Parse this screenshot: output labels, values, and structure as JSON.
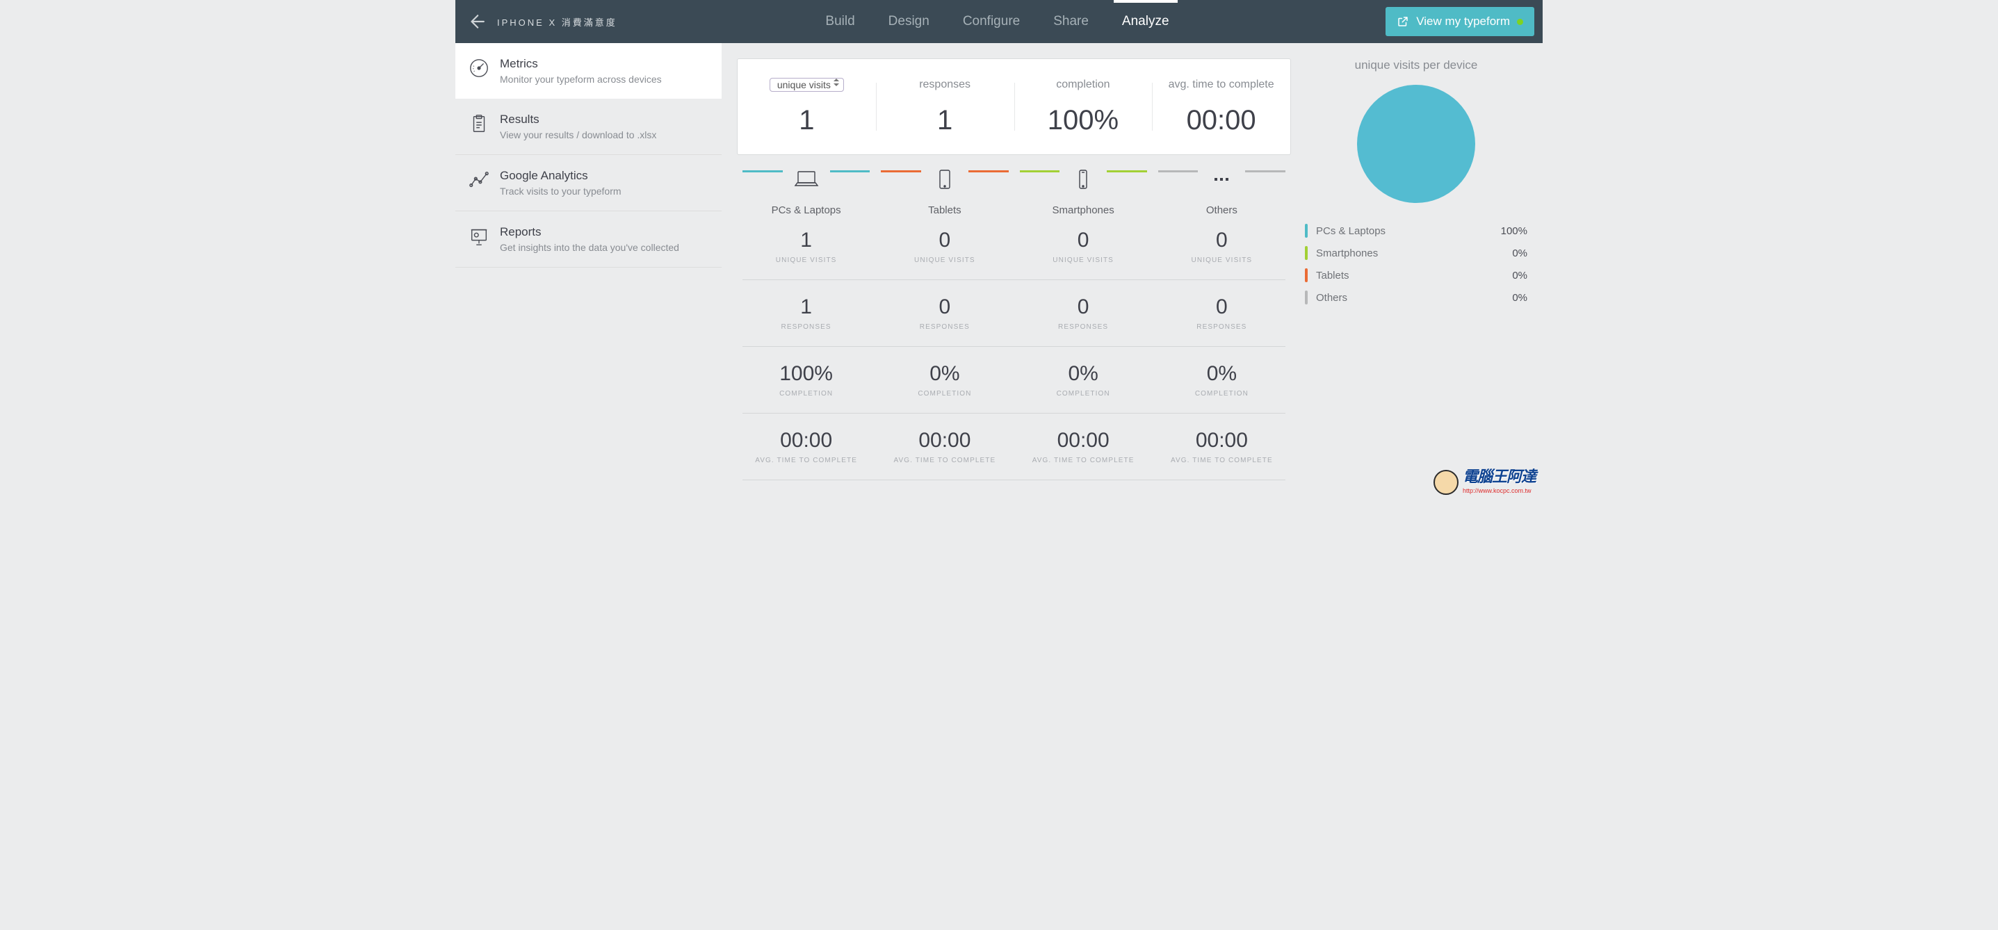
{
  "header": {
    "form_title": "IPHONE X 消費滿意度",
    "nav": [
      "Build",
      "Design",
      "Configure",
      "Share",
      "Analyze"
    ],
    "active_nav": "Analyze",
    "view_btn": "View my typeform"
  },
  "sidebar": [
    {
      "title": "Metrics",
      "sub": "Monitor your typeform across devices",
      "icon": "gauge",
      "active": true
    },
    {
      "title": "Results",
      "sub": "View your results / download to .xlsx",
      "icon": "clipboard"
    },
    {
      "title": "Google Analytics",
      "sub": "Track visits to your typeform",
      "icon": "chart"
    },
    {
      "title": "Reports",
      "sub": "Get insights into the data you've collected",
      "icon": "presentation"
    }
  ],
  "summary": {
    "select": "unique visits",
    "unique_visits": "1",
    "responses_label": "responses",
    "responses": "1",
    "completion_label": "completion",
    "completion": "100%",
    "avg_label": "avg. time to complete",
    "avg": "00:00"
  },
  "devices": {
    "columns": [
      {
        "name": "PCs & Laptops",
        "color": "#4fbbc6",
        "icon": "laptop",
        "unique_visits": "1",
        "responses": "1",
        "completion": "100%",
        "avg": "00:00"
      },
      {
        "name": "Tablets",
        "color": "#ea6b35",
        "icon": "tablet",
        "unique_visits": "0",
        "responses": "0",
        "completion": "0%",
        "avg": "00:00"
      },
      {
        "name": "Smartphones",
        "color": "#a2d035",
        "icon": "phone",
        "unique_visits": "0",
        "responses": "0",
        "completion": "0%",
        "avg": "00:00"
      },
      {
        "name": "Others",
        "color": "#b7b8b9",
        "icon": "dots",
        "unique_visits": "0",
        "responses": "0",
        "completion": "0%",
        "avg": "00:00"
      }
    ],
    "row_labels": {
      "unique": "UNIQUE VISITS",
      "responses": "RESPONSES",
      "completion": "COMPLETION",
      "avg": "AVG. TIME TO COMPLETE"
    }
  },
  "right": {
    "title": "unique visits per device",
    "legend": [
      {
        "name": "PCs & Laptops",
        "value": "100%",
        "color": "#4fbbc6"
      },
      {
        "name": "Smartphones",
        "value": "0%",
        "color": "#a2d035"
      },
      {
        "name": "Tablets",
        "value": "0%",
        "color": "#ea6b35"
      },
      {
        "name": "Others",
        "value": "0%",
        "color": "#b7b8b9"
      }
    ]
  },
  "chart_data": {
    "type": "pie",
    "title": "unique visits per device",
    "categories": [
      "PCs & Laptops",
      "Smartphones",
      "Tablets",
      "Others"
    ],
    "values": [
      100,
      0,
      0,
      0
    ],
    "colors": [
      "#4fbbc6",
      "#a2d035",
      "#ea6b35",
      "#b7b8b9"
    ]
  },
  "watermark": {
    "big": "電腦王阿達",
    "small": "http://www.kocpc.com.tw"
  }
}
